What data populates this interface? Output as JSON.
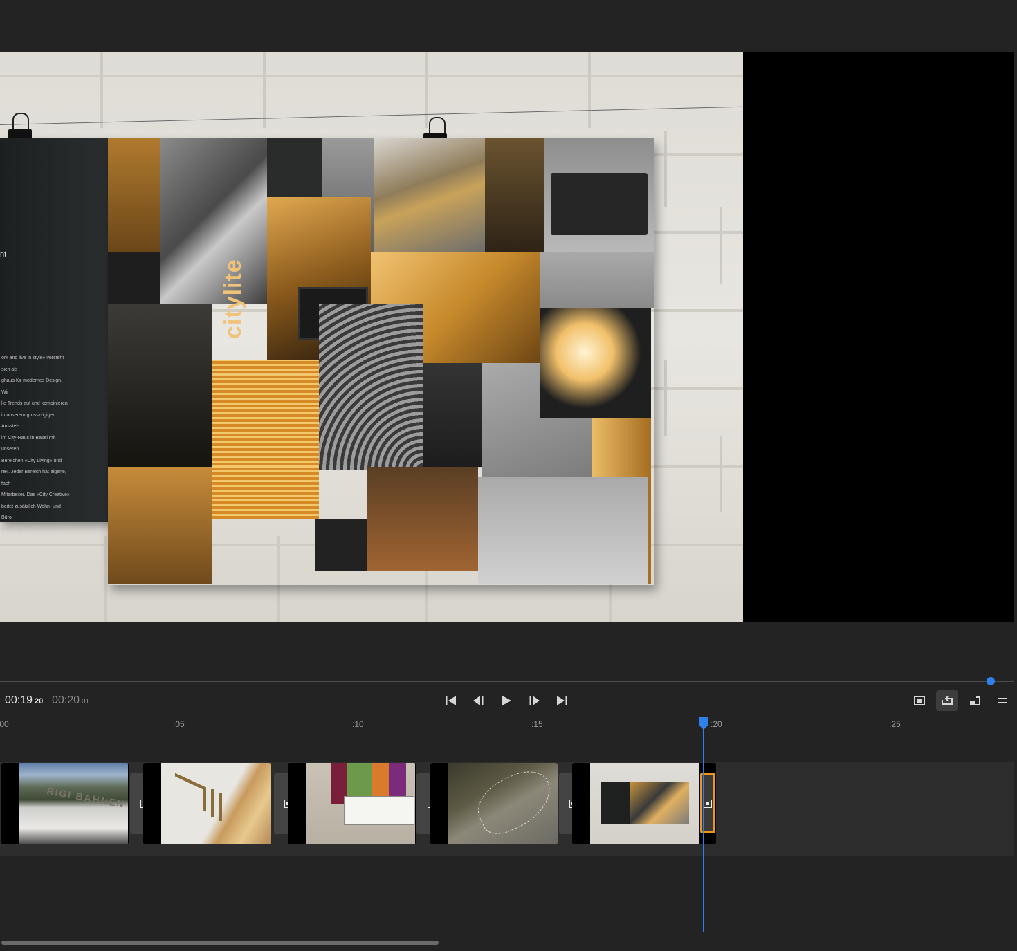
{
  "transport": {
    "current_time": "00:19",
    "current_frames": "20",
    "total_time": "00:20",
    "total_frames": "01"
  },
  "ruler": {
    "labels": [
      ":00",
      ":05",
      ":10",
      ":15",
      ":20",
      ":25"
    ]
  },
  "preview": {
    "brochure_brand": "citylite",
    "brochure_heading": "nt",
    "brochure_body": "ork and live in style» versteht sich als\nghaus für modernes Design. Wir\nlie Trends auf und kombinieren\nin unserem grosszügigen Ausstel-\nim City-Haus in Basel mit unseren\nBereichen «City Living» und\nre». Jeder Bereich hat eigene, fach-\nMitarbeiter. Das «City Creative»\nbeitet zusätzlich Wohn- und Büro-\ngslösungen nach Ihrem Plan."
  },
  "timeline": {
    "first_clip_sign": "RIGI BAHNEN",
    "playhead_seconds": 19.8,
    "scroll_position": 0.0
  },
  "icons": {
    "skip_start": "skip-to-start-icon",
    "step_back": "step-back-icon",
    "play": "play-icon",
    "step_forward": "step-forward-icon",
    "skip_end": "skip-to-end-icon",
    "fit": "fit-to-screen-icon",
    "loop": "loop-icon",
    "pip": "picture-in-picture-icon",
    "menu": "menu-icon",
    "transition": "transition-icon"
  },
  "colors": {
    "accent_blue": "#2f80ed",
    "selection_orange": "#f0951c",
    "background": "#232323"
  }
}
